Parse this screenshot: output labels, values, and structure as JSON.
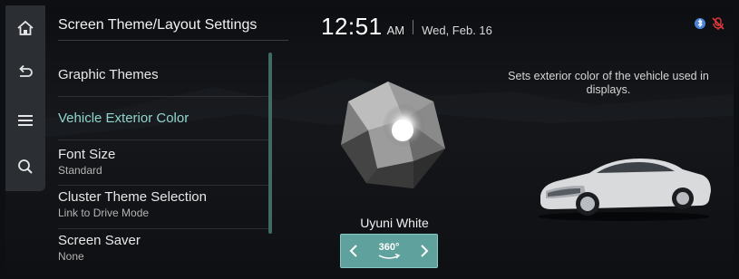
{
  "header": {
    "title": "Screen Theme/Layout Settings",
    "time": "12:51",
    "ampm": "AM",
    "date": "Wed, Feb. 16"
  },
  "rail": {
    "icons": [
      "home-icon",
      "back-icon",
      "menu-icon",
      "search-icon"
    ]
  },
  "menu": {
    "items": [
      {
        "label": "Graphic Themes",
        "sub": ""
      },
      {
        "label": "Vehicle Exterior Color",
        "sub": "",
        "active": true
      },
      {
        "label": "Font Size",
        "sub": "Standard"
      },
      {
        "label": "Cluster Theme Selection",
        "sub": "Link to Drive Mode"
      },
      {
        "label": "Screen Saver",
        "sub": "None"
      }
    ]
  },
  "preview": {
    "color_name": "Uyuni White",
    "rotate_label": "360°",
    "description": "Sets exterior color of the vehicle used in displays."
  },
  "colors": {
    "accent": "#8fd6cf",
    "button_bg": "#5fa19c",
    "background": "#0d0f12"
  },
  "status_icons": [
    "bluetooth-voice-icon",
    "mic-off-icon"
  ]
}
